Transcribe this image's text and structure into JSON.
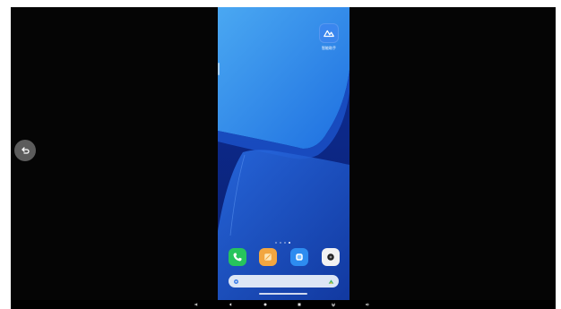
{
  "screen": {
    "type": "android-phone-mirror"
  },
  "back_button": {
    "icon": "return-icon"
  },
  "home_screen": {
    "app": {
      "label": "智能助手",
      "icon": "app-mountain-icon"
    },
    "page_indicator": {
      "count": 4,
      "active": 3
    },
    "dock": [
      {
        "name": "phone",
        "icon": "phone-icon",
        "color": "#27c45c"
      },
      {
        "name": "notes",
        "icon": "notes-icon",
        "color": "#f2a640"
      },
      {
        "name": "messages",
        "icon": "messages-icon",
        "color": "#2d8cf0"
      },
      {
        "name": "camera",
        "icon": "camera-icon",
        "color": "#f2f2f2"
      }
    ],
    "search_bar": {
      "left_icon": "search-icon",
      "right_icon": "assistant-icon"
    }
  },
  "nav_bar": {
    "items": [
      "volume-down-icon",
      "back-icon",
      "home-icon",
      "recents-icon",
      "hide-icon",
      "volume-up-icon"
    ]
  }
}
